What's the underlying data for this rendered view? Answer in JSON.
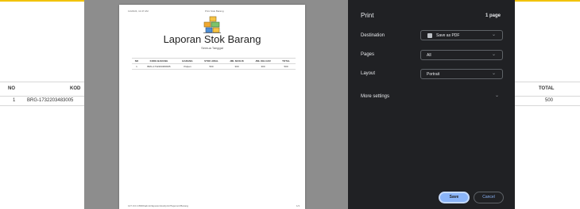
{
  "background_table": {
    "headers": {
      "no": "NO",
      "kode": "KOD",
      "total": "TOTAL"
    },
    "row": {
      "no": "1",
      "code": "BRG-1732203483005",
      "total": "500"
    }
  },
  "document": {
    "header_left": "11/22/24, 11:47 AM",
    "header_center": "Print Stok Barang",
    "title": "Laporan Stok Barang",
    "subtitle": "Semua Tanggal",
    "table": {
      "headers": [
        "NO",
        "KODE BARANG",
        "BARANG",
        "STOK AWAL",
        "JML MASUK",
        "JML KELUAR",
        "TOTAL"
      ],
      "rows": [
        [
          "1",
          "BRG-1732203483005",
          "Pulpen",
          "500",
          "300",
          "300",
          "500"
        ]
      ]
    },
    "footer_left": "127.0.0.1:8000/admin/laporan/stok/print?laporan=Barang",
    "footer_right": "1/1"
  },
  "print_panel": {
    "title": "Print",
    "page_count": "1 page",
    "destination": {
      "label": "Destination",
      "value": "Save as PDF"
    },
    "pages": {
      "label": "Pages",
      "value": "All"
    },
    "layout": {
      "label": "Layout",
      "value": "Portrait"
    },
    "more_settings": "More settings",
    "save_label": "Save",
    "cancel_label": "Cancel"
  },
  "colors": {
    "panel_bg": "#202124",
    "accent": "#8ab4f8",
    "preview_bg": "#8d8d8d",
    "top_accent": "#f2c200"
  },
  "icons": {
    "logo": "warehouse-boxes-icon",
    "pdf": "pdf-file-icon",
    "chevron": "chevron-down-icon"
  }
}
